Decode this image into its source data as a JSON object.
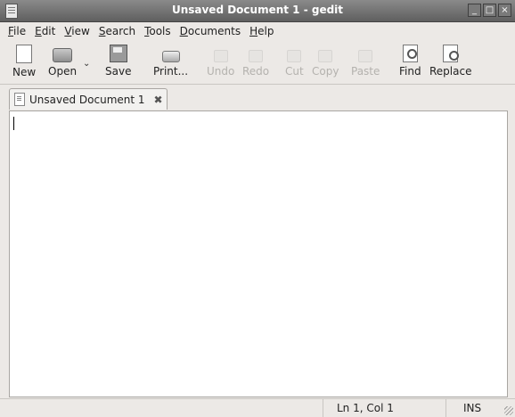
{
  "window": {
    "title": "Unsaved Document 1 - gedit"
  },
  "menu": [
    {
      "mn": "F",
      "rest": "ile"
    },
    {
      "mn": "E",
      "rest": "dit"
    },
    {
      "mn": "V",
      "rest": "iew"
    },
    {
      "mn": "S",
      "rest": "earch"
    },
    {
      "mn": "T",
      "rest": "ools"
    },
    {
      "mn": "D",
      "rest": "ocuments"
    },
    {
      "mn": "H",
      "rest": "elp"
    }
  ],
  "toolbar": {
    "new": "New",
    "open": "Open",
    "save": "Save",
    "print": "Print...",
    "undo": "Undo",
    "redo": "Redo",
    "cut": "Cut",
    "copy": "Copy",
    "paste": "Paste",
    "find": "Find",
    "replace": "Replace"
  },
  "tab": {
    "label": "Unsaved Document 1",
    "close_glyph": "✖"
  },
  "editor": {
    "content": ""
  },
  "status": {
    "position": "Ln 1, Col 1",
    "mode": "INS"
  }
}
